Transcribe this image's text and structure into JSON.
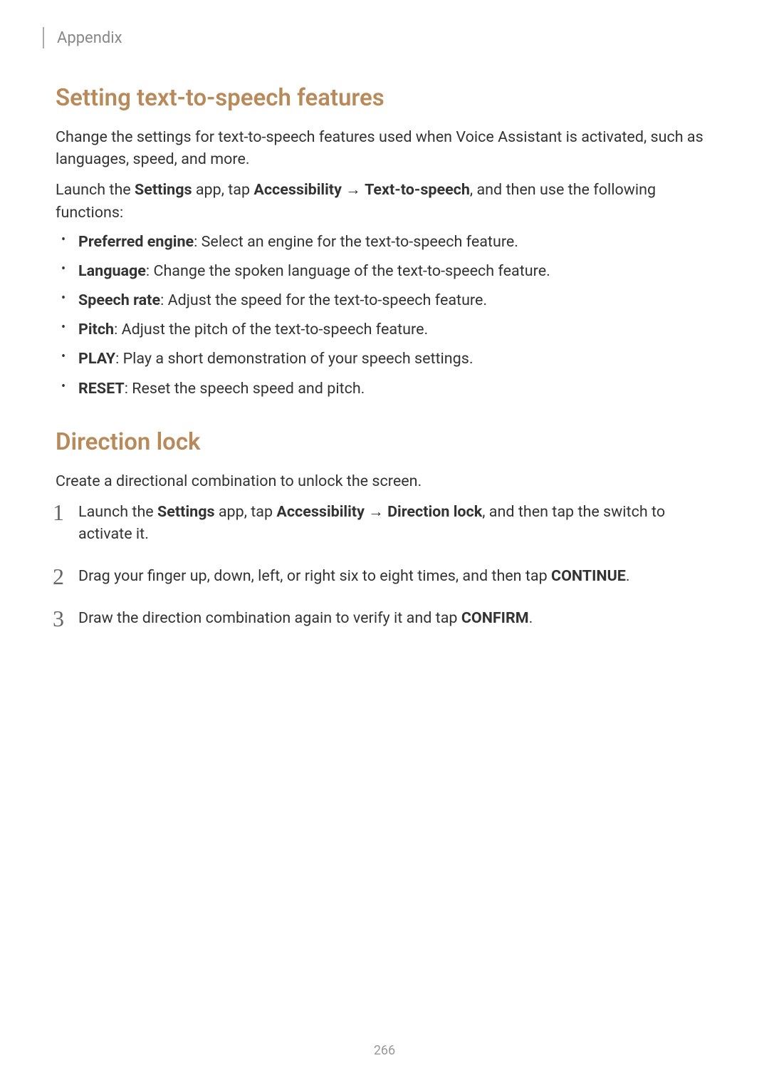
{
  "header": {
    "section": "Appendix"
  },
  "section1": {
    "title": "Setting text-to-speech features",
    "intro": "Change the settings for text-to-speech features used when Voice Assistant is activated, such as languages, speed, and more.",
    "launch_prefix": "Launch the ",
    "settings_bold": "Settings",
    "launch_mid1": " app, tap ",
    "accessibility_bold": "Accessibility",
    "arrow": " → ",
    "tts_bold": "Text-to-speech",
    "launch_suffix": ", and then use the following functions:",
    "bullets": [
      {
        "bold": "Preferred engine",
        "text": ": Select an engine for the text-to-speech feature."
      },
      {
        "bold": "Language",
        "text": ": Change the spoken language of the text-to-speech feature."
      },
      {
        "bold": "Speech rate",
        "text": ": Adjust the speed for the text-to-speech feature."
      },
      {
        "bold": "Pitch",
        "text": ": Adjust the pitch of the text-to-speech feature."
      },
      {
        "bold": "PLAY",
        "text": ": Play a short demonstration of your speech settings."
      },
      {
        "bold": "RESET",
        "text": ": Reset the speech speed and pitch."
      }
    ]
  },
  "section2": {
    "title": "Direction lock",
    "intro": "Create a directional combination to unlock the screen.",
    "steps": {
      "num1": "1",
      "num2": "2",
      "num3": "3",
      "s1_prefix": "Launch the ",
      "s1_settings": "Settings",
      "s1_mid1": " app, tap ",
      "s1_access": "Accessibility",
      "s1_arrow": " → ",
      "s1_dirlock": "Direction lock",
      "s1_suffix": ", and then tap the switch to activate it.",
      "s2_prefix": "Drag your finger up, down, left, or right six to eight times, and then tap ",
      "s2_continue": "CONTINUE",
      "s2_suffix": ".",
      "s3_prefix": "Draw the direction combination again to verify it and tap ",
      "s3_confirm": "CONFIRM",
      "s3_suffix": "."
    }
  },
  "pageNumber": "266"
}
